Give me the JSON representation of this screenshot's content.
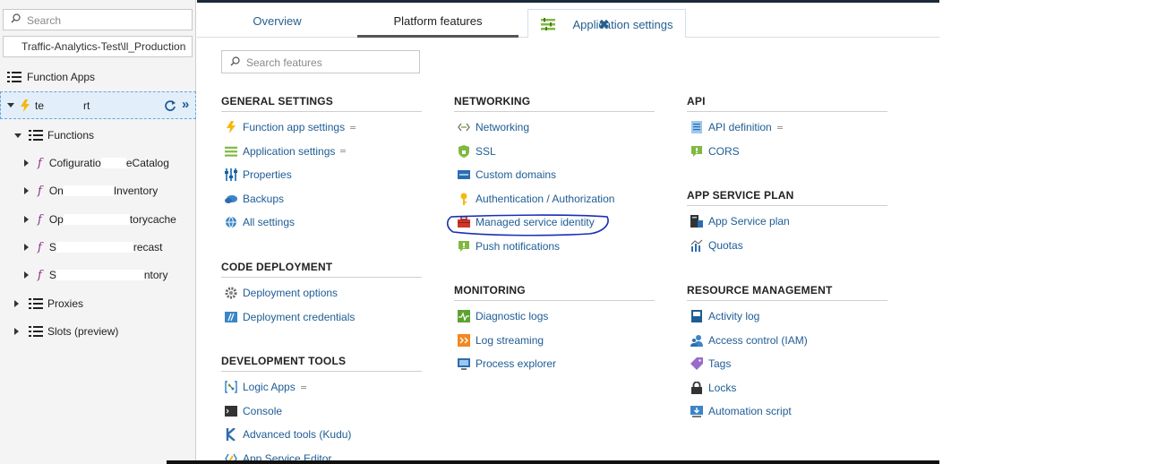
{
  "sidebar": {
    "search_placeholder": "Search",
    "subscription": "Traffic-Analytics-Test\\ll_Production",
    "function_apps_label": "Function Apps",
    "app_name": "te",
    "app_name_tail": "rt",
    "functions_label": "Functions",
    "functions": [
      {
        "start": "Co",
        "mid": "figuratio",
        "end": "eCatalog"
      },
      {
        "start": "On",
        "mid": "",
        "end": "Inventory"
      },
      {
        "start": "Op",
        "mid": "",
        "end": "torycache"
      },
      {
        "start": "S",
        "mid": "",
        "end": "recast"
      },
      {
        "start": "S",
        "mid": "",
        "end": "ntory"
      }
    ],
    "proxies_label": "Proxies",
    "slots_label": "Slots (preview)"
  },
  "tabs": {
    "overview": "Overview",
    "platform": "Platform features",
    "app_settings": "Application settings"
  },
  "search": {
    "placeholder": "Search features"
  },
  "sections": {
    "general": {
      "title": "GENERAL SETTINGS",
      "items": [
        "Function app settings",
        "Application settings",
        "Properties",
        "Backups",
        "All settings"
      ]
    },
    "code_deploy": {
      "title": "CODE DEPLOYMENT",
      "items": [
        "Deployment options",
        "Deployment credentials"
      ]
    },
    "dev_tools": {
      "title": "DEVELOPMENT TOOLS",
      "items": [
        "Logic Apps",
        "Console",
        "Advanced tools (Kudu)",
        "App Service Editor"
      ]
    },
    "networking": {
      "title": "NETWORKING",
      "items": [
        "Networking",
        "SSL",
        "Custom domains",
        "Authentication / Authorization",
        "Managed service identity",
        "Push notifications"
      ]
    },
    "monitoring": {
      "title": "MONITORING",
      "items": [
        "Diagnostic logs",
        "Log streaming",
        "Process explorer"
      ]
    },
    "api": {
      "title": "API",
      "items": [
        "API definition",
        "CORS"
      ]
    },
    "plan": {
      "title": "APP SERVICE PLAN",
      "items": [
        "App Service plan",
        "Quotas"
      ]
    },
    "resource": {
      "title": "RESOURCE MANAGEMENT",
      "items": [
        "Activity log",
        "Access control (IAM)",
        "Tags",
        "Locks",
        "Automation script"
      ]
    }
  },
  "colors": {
    "link": "#1e5c94",
    "highlight": "#1a2fb5",
    "accent": "#255f8f"
  }
}
